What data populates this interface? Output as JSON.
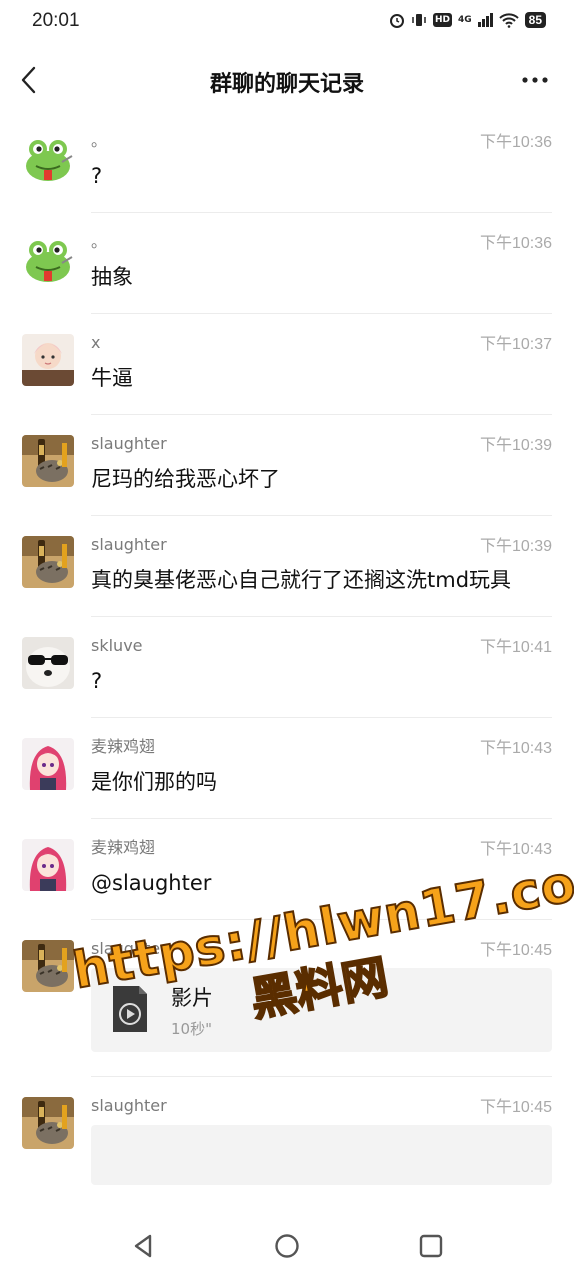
{
  "status_bar": {
    "time": "20:01",
    "network": "4G",
    "hd": "HD",
    "battery": "85"
  },
  "header": {
    "title": "群聊的聊天记录"
  },
  "messages": [
    {
      "sender": "。",
      "time": "下午10:36",
      "text": "?",
      "avatar": "frog-avatar"
    },
    {
      "sender": "。",
      "time": "下午10:36",
      "text": "抽象",
      "avatar": "frog-avatar"
    },
    {
      "sender": "x",
      "time": "下午10:37",
      "text": "牛逼",
      "avatar": "anime-girl-avatar"
    },
    {
      "sender": "slaughter",
      "time": "下午10:39",
      "text": "尼玛的给我恶心坏了",
      "avatar": "cat-bottle-avatar"
    },
    {
      "sender": "slaughter",
      "time": "下午10:39",
      "text": "真的臭基佬恶心自己就行了还搁这洗tmd玩具",
      "avatar": "cat-bottle-avatar"
    },
    {
      "sender": "skluve",
      "time": "下午10:41",
      "text": "?",
      "avatar": "dog-sunglasses-avatar"
    },
    {
      "sender": "麦辣鸡翅",
      "time": "下午10:43",
      "text": "是你们那的吗",
      "avatar": "pink-hair-avatar"
    },
    {
      "sender": "麦辣鸡翅",
      "time": "下午10:43",
      "text": "@slaughter",
      "avatar": "pink-hair-avatar"
    },
    {
      "sender": "slaughter",
      "time": "下午10:45",
      "file_name": "影片",
      "file_duration": "10秒\"",
      "avatar": "cat-bottle-avatar"
    },
    {
      "sender": "slaughter",
      "time": "下午10:45",
      "avatar": "cat-bottle-avatar"
    }
  ],
  "watermark": {
    "url": "https://hlwn17.com",
    "name": "黑料网"
  },
  "colors": {
    "watermark_fill": "#f6a21a",
    "watermark_stroke": "#5a2d00",
    "timestamp": "#aaaaaa",
    "sender": "#7a7a7a"
  }
}
